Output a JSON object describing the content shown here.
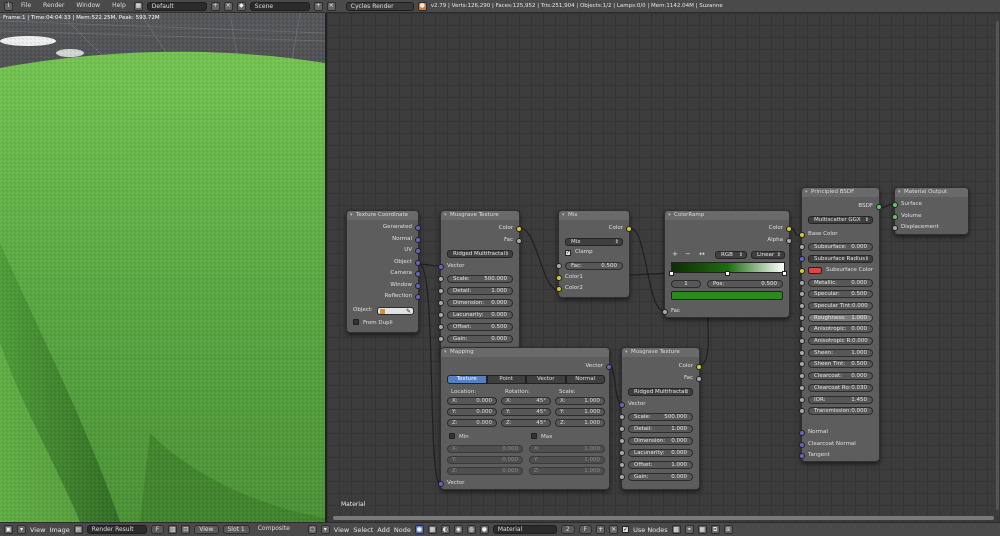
{
  "topbar": {
    "menus": [
      "File",
      "Render",
      "Window",
      "Help"
    ],
    "screen_layout": "Default",
    "scene": "Scene",
    "engine": "Cycles Render",
    "stats": "v2.79 | Verts:126,290 | Faces:125,952 | Tris:251,904 | Objects:1/2 | Lamps:0/0 | Mem:1142.04M | Suzanne"
  },
  "viewport": {
    "info": "Frame:1 | Time:04:04.33 | Mem:522.25M, Peak: 593.72M"
  },
  "editor": {
    "label": "Material"
  },
  "nodes": {
    "texcoord": {
      "title": "Texture Coordinate",
      "outputs": [
        "Generated",
        "Normal",
        "UV",
        "Object",
        "Camera",
        "Window",
        "Reflection"
      ],
      "object_label": "Object:",
      "from_dupli": "From Dupli"
    },
    "musgrave1": {
      "title": "Musgrave Texture",
      "outputs": [
        "Color",
        "Fac"
      ],
      "type": "Ridged Multifractal",
      "input_vector": "Vector",
      "params": [
        {
          "label": "Scale:",
          "value": "500.000"
        },
        {
          "label": "Detail:",
          "value": "1.000"
        },
        {
          "label": "Dimension:",
          "value": "0.000"
        },
        {
          "label": "Lacunarity:",
          "value": "0.000"
        },
        {
          "label": "Offset:",
          "value": "0.500"
        },
        {
          "label": "Gain:",
          "value": "0.000"
        }
      ]
    },
    "mix": {
      "title": "Mix",
      "output": "Color",
      "blend": "Mix",
      "clamp": "Clamp",
      "fac_label": "Fac:",
      "fac_value": "0.500",
      "inputs": [
        "Color1",
        "Color2"
      ]
    },
    "colorramp": {
      "title": "ColorRamp",
      "outputs": [
        "Color",
        "Alpha"
      ],
      "mode": "RGB",
      "interp": "Linear",
      "index": "1",
      "pos_label": "Pos:",
      "pos_value": "0.500",
      "input": "Fac",
      "buttons": [
        "+",
        "−",
        "↔"
      ],
      "colors": {
        "dark": "#0d2e05",
        "mid": "#1e6d0f",
        "swatch": "#2b8a1c"
      }
    },
    "bsdf": {
      "title": "Principled BSDF",
      "output": "BSDF",
      "distribution": "Multiscatter GGX",
      "base_color": "Base Color",
      "subsurface": {
        "label": "Subsurface:",
        "value": "0.000"
      },
      "subsurface_radius": "Subsurface Radius",
      "subsurface_color": "Subsurface Color",
      "subsurface_swatch": "#e04545",
      "params": [
        {
          "label": "Metallic:",
          "value": "0.000"
        },
        {
          "label": "Specular:",
          "value": "0.500"
        },
        {
          "label": "Specular Tint:",
          "value": "0.000"
        },
        {
          "label": "Roughness:",
          "value": "1.000"
        },
        {
          "label": "Anisotropic:",
          "value": "0.000"
        },
        {
          "label": "Anisotropic R:",
          "value": "0.000"
        },
        {
          "label": "Sheen:",
          "value": "1.000"
        },
        {
          "label": "Sheen Tint:",
          "value": "0.500"
        },
        {
          "label": "Clearcoat:",
          "value": "0.000"
        },
        {
          "label": "Clearcoat Ro:",
          "value": "0.030"
        },
        {
          "label": "IOR:",
          "value": "1.450"
        },
        {
          "label": "Transmission:",
          "value": "0.000"
        }
      ],
      "inputs_tail": [
        "Normal",
        "Clearcoat Normal",
        "Tangent"
      ]
    },
    "output": {
      "title": "Material Output",
      "inputs": [
        "Surface",
        "Volume",
        "Displacement"
      ]
    },
    "mapping": {
      "title": "Mapping",
      "output": "Vector",
      "tabs": [
        "Texture",
        "Point",
        "Vector",
        "Normal"
      ],
      "active_tab": "Texture",
      "col_headers": [
        "Location:",
        "Rotation:",
        "Scale:"
      ],
      "location": [
        {
          "a": "X:",
          "v": "0.000"
        },
        {
          "a": "Y:",
          "v": "0.000"
        },
        {
          "a": "Z:",
          "v": "0.000"
        }
      ],
      "rotation": [
        {
          "a": "X:",
          "v": "45°"
        },
        {
          "a": "Y:",
          "v": "45°"
        },
        {
          "a": "Z:",
          "v": "45°"
        }
      ],
      "scale": [
        {
          "a": "X:",
          "v": "1.000"
        },
        {
          "a": "Y:",
          "v": "1.000"
        },
        {
          "a": "Z:",
          "v": "1.000"
        }
      ],
      "min": "Min",
      "max": "Max",
      "minvals": [
        {
          "a": "X:",
          "v": "0.000"
        },
        {
          "a": "Y:",
          "v": "0.000"
        },
        {
          "a": "Z:",
          "v": "0.000"
        }
      ],
      "maxvals": [
        {
          "a": "X:",
          "v": "1.000"
        },
        {
          "a": "Y:",
          "v": "1.000"
        },
        {
          "a": "Z:",
          "v": "1.000"
        }
      ],
      "input": "Vector"
    },
    "musgrave2": {
      "title": "Musgrave Texture",
      "outputs": [
        "Color",
        "Fac"
      ],
      "type": "Ridged Multifractal",
      "input_vector": "Vector",
      "params": [
        {
          "label": "Scale:",
          "value": "500.000"
        },
        {
          "label": "Detail:",
          "value": "1.000"
        },
        {
          "label": "Dimension:",
          "value": "0.000"
        },
        {
          "label": "Lacunarity:",
          "value": "0.000"
        },
        {
          "label": "Offset:",
          "value": "1.000"
        },
        {
          "label": "Gain:",
          "value": "0.000"
        }
      ]
    }
  },
  "bottombar": {
    "left": {
      "menus": [
        "View",
        "Image"
      ],
      "image": "Render Result",
      "f": "F",
      "view": "View",
      "slot": "Slot 1",
      "composite": "Composite"
    },
    "right": {
      "menus": [
        "View",
        "Select",
        "Add",
        "Node"
      ],
      "material": "Material",
      "users": "2",
      "f": "F",
      "use_nodes": "Use Nodes"
    }
  }
}
